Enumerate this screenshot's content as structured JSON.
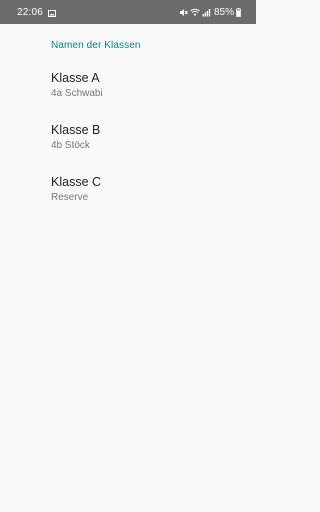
{
  "status_bar": {
    "time": "22:06",
    "battery_percent": "85%",
    "icons": [
      "image-icon",
      "mute-icon",
      "wifi-icon",
      "signal-icon",
      "battery-icon"
    ]
  },
  "preferences": {
    "section_title": "Namen der Klassen",
    "items": [
      {
        "title": "Klasse A",
        "summary": "4a Schwabi"
      },
      {
        "title": "Klasse B",
        "summary": "4b Stöck"
      },
      {
        "title": "Klasse C",
        "summary": "Reserve"
      }
    ]
  },
  "colors": {
    "status_bar_bg": "#6b6b6b",
    "accent": "#00897b",
    "background": "#fafafa",
    "title_text": "#202124",
    "summary_text": "#757575"
  }
}
